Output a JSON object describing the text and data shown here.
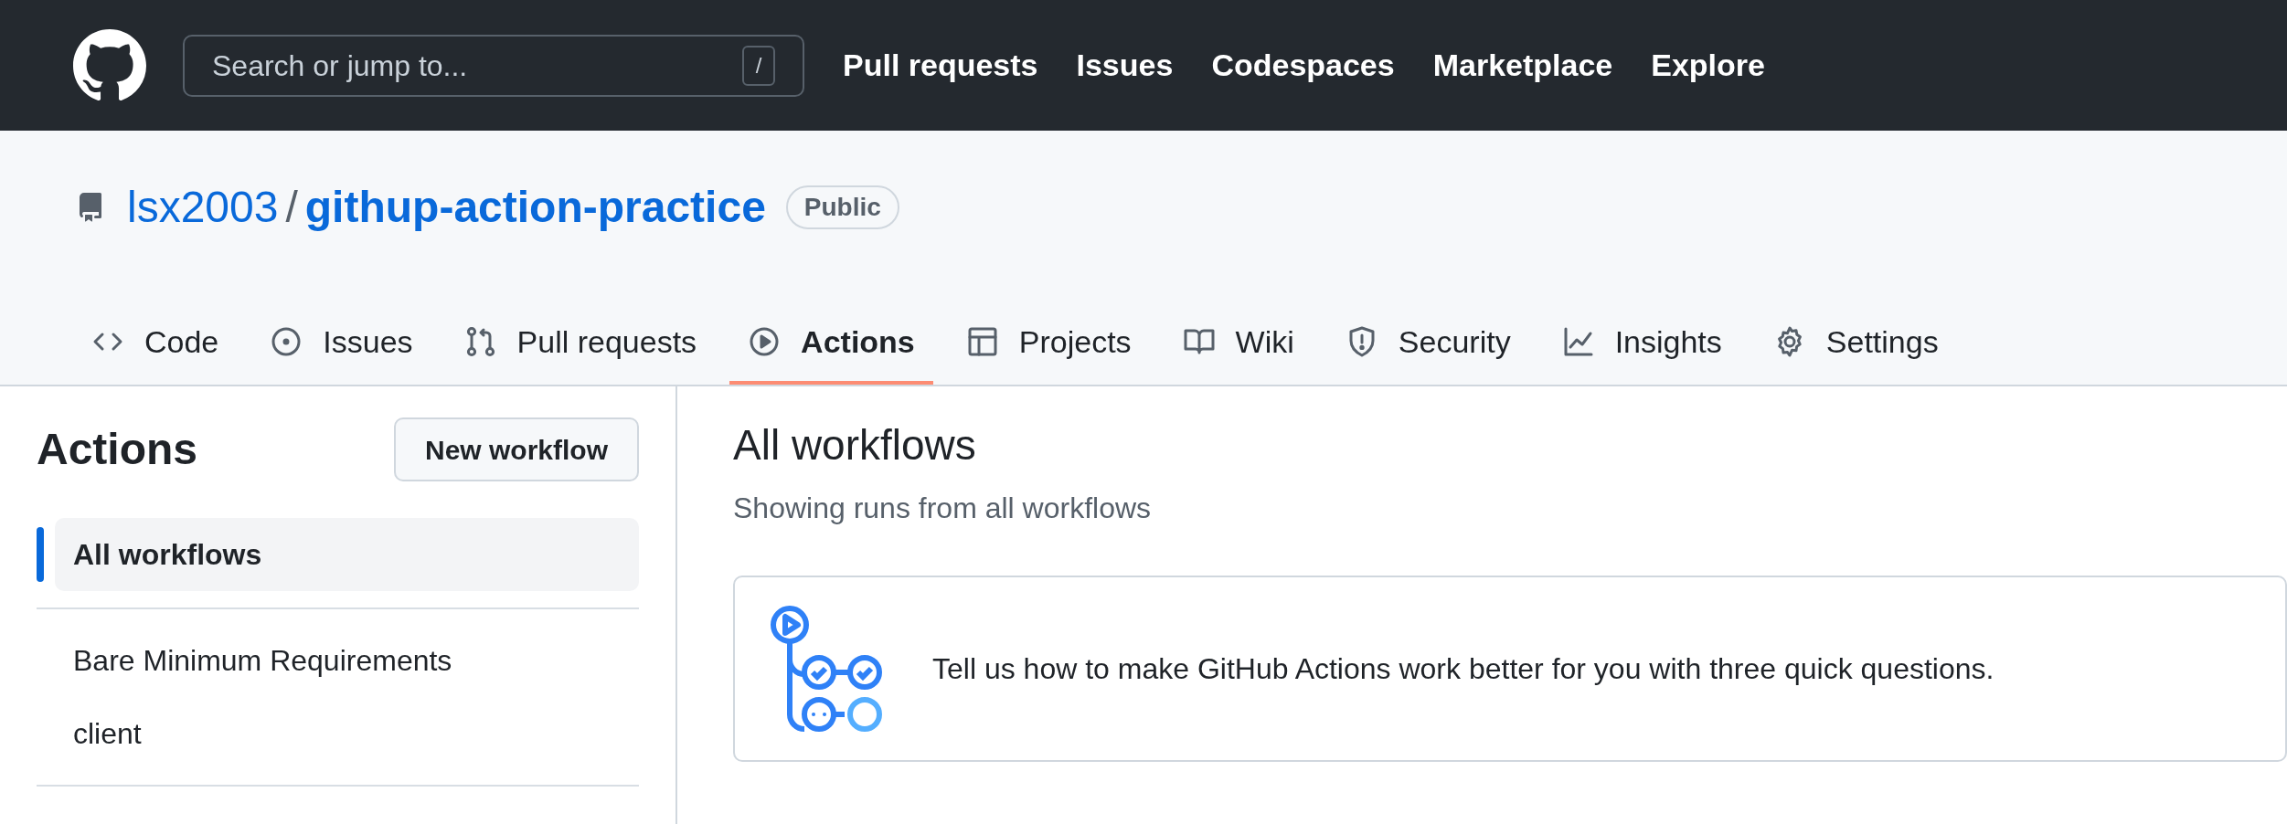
{
  "header": {
    "search": {
      "placeholder": "Search or jump to...",
      "shortcut": "/"
    },
    "nav": [
      "Pull requests",
      "Issues",
      "Codespaces",
      "Marketplace",
      "Explore"
    ]
  },
  "repo": {
    "owner": "lsx2003",
    "separator": "/",
    "name": "githup-action-practice",
    "visibility": "Public"
  },
  "tabs": [
    {
      "kind": "code",
      "label": "Code",
      "selected": false
    },
    {
      "kind": "issues",
      "label": "Issues",
      "selected": false
    },
    {
      "kind": "pulls",
      "label": "Pull requests",
      "selected": false
    },
    {
      "kind": "actions",
      "label": "Actions",
      "selected": true
    },
    {
      "kind": "projects",
      "label": "Projects",
      "selected": false
    },
    {
      "kind": "wiki",
      "label": "Wiki",
      "selected": false
    },
    {
      "kind": "security",
      "label": "Security",
      "selected": false
    },
    {
      "kind": "insights",
      "label": "Insights",
      "selected": false
    },
    {
      "kind": "settings",
      "label": "Settings",
      "selected": false
    }
  ],
  "sidebar": {
    "title": "Actions",
    "new_button": "New workflow",
    "items": [
      {
        "label": "All workflows",
        "selected": true
      }
    ],
    "workflows": [
      {
        "label": "Bare Minimum Requirements",
        "selected": false
      },
      {
        "label": "client",
        "selected": false
      }
    ]
  },
  "main": {
    "title": "All workflows",
    "subtitle": "Showing runs from all workflows",
    "banner": {
      "text": "Tell us how to make GitHub Actions work better for you with three quick questions."
    }
  }
}
